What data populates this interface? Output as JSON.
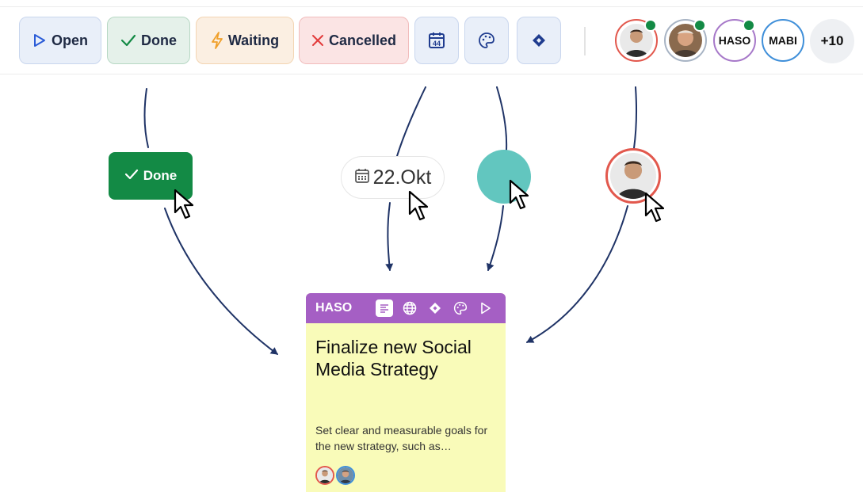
{
  "toolbar": {
    "status_buttons": [
      {
        "label": "Open",
        "icon": "play-outline-icon"
      },
      {
        "label": "Done",
        "icon": "check-icon"
      },
      {
        "label": "Waiting",
        "icon": "lightning-icon"
      },
      {
        "label": "Cancelled",
        "icon": "x-icon"
      }
    ],
    "icon_buttons": [
      {
        "icon": "calendar-icon",
        "calendar_number": "44"
      },
      {
        "icon": "palette-icon"
      },
      {
        "icon": "diamond-icon"
      }
    ],
    "avatars": [
      {
        "kind": "photo",
        "icon": "user-photo-avatar",
        "online": true
      },
      {
        "kind": "photo",
        "icon": "user-photo-avatar",
        "online": true
      },
      {
        "kind": "initials",
        "initials": "HASO",
        "online": true
      },
      {
        "kind": "initials",
        "initials": "MABI",
        "online": false
      }
    ],
    "more_count": "+10"
  },
  "drag_items": {
    "done_chip": {
      "label": "Done",
      "icon": "check-icon"
    },
    "date_chip": {
      "label": "22.Okt",
      "icon": "calendar-icon"
    },
    "color_swatch": {
      "color": "#62c6bf"
    },
    "avatar": {
      "icon": "user-photo-avatar"
    }
  },
  "card": {
    "tag": "HASO",
    "header_icons": [
      "description-icon",
      "globe-icon",
      "diamond-icon",
      "palette-icon",
      "play-outline-icon"
    ],
    "title": "Finalize new Social Media Strategy",
    "description": "Set clear and measurable goals for the new strategy, such as…"
  },
  "colors": {
    "done_green": "#138a45",
    "card_header_purple": "#a55fc4",
    "card_body_yellow": "#f9fbb9",
    "arrow_navy": "#1f3366",
    "swatch_teal": "#62c6bf"
  }
}
